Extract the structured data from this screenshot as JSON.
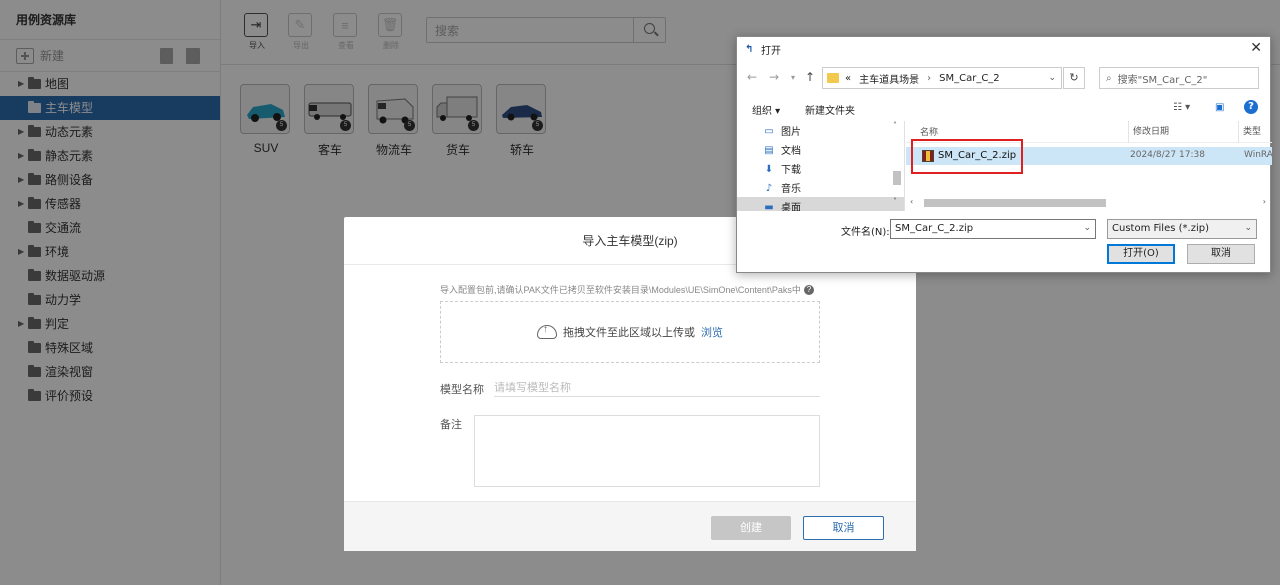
{
  "sidebar": {
    "title": "用例资源库",
    "new_label": "新建",
    "items": [
      {
        "label": "地图",
        "has_children": true
      },
      {
        "label": "主车模型",
        "has_children": false,
        "active": true
      },
      {
        "label": "动态元素",
        "has_children": true
      },
      {
        "label": "静态元素",
        "has_children": true
      },
      {
        "label": "路侧设备",
        "has_children": true
      },
      {
        "label": "传感器",
        "has_children": true
      },
      {
        "label": "交通流",
        "has_children": false
      },
      {
        "label": "环境",
        "has_children": true
      },
      {
        "label": "数据驱动源",
        "has_children": false
      },
      {
        "label": "动力学",
        "has_children": false
      },
      {
        "label": "判定",
        "has_children": true
      },
      {
        "label": "特殊区域",
        "has_children": false
      },
      {
        "label": "渲染视窗",
        "has_children": false
      },
      {
        "label": "评价预设",
        "has_children": false
      }
    ]
  },
  "toolbar": {
    "import_label": "导入",
    "export_label": "导出",
    "view_label": "查看",
    "delete_label": "删除",
    "search_placeholder": "搜索"
  },
  "vehicles": [
    {
      "name": "SUV",
      "color": "#2aa7c9"
    },
    {
      "name": "客车",
      "color": "#d8d8d8"
    },
    {
      "name": "物流车",
      "color": "#ededed"
    },
    {
      "name": "货车",
      "color": "#e0e0e0"
    },
    {
      "name": "轿车",
      "color": "#2e4f86"
    }
  ],
  "import_dialog": {
    "title": "导入主车模型(zip)",
    "hint": "导入配置包前,请确认PAK文件已拷贝至软件安装目录\\Modules\\UE\\SimOne\\Content\\Paks中",
    "drop_text": "拖拽文件至此区域以上传或",
    "browse_label": "浏览",
    "name_label": "模型名称",
    "name_placeholder": "请填写模型名称",
    "remark_label": "备注",
    "create_label": "创建",
    "cancel_label": "取消"
  },
  "open_dialog": {
    "title": "打开",
    "breadcrumb_prefix": "«",
    "path": [
      "主车道具场景",
      "SM_Car_C_2"
    ],
    "search_placeholder": "搜索\"SM_Car_C_2\"",
    "organize_label": "组织 ▾",
    "new_folder_label": "新建文件夹",
    "nav_items": [
      {
        "label": "图片",
        "icon": "pictures-icon"
      },
      {
        "label": "文档",
        "icon": "documents-icon"
      },
      {
        "label": "下载",
        "icon": "downloads-icon"
      },
      {
        "label": "音乐",
        "icon": "music-icon"
      },
      {
        "label": "桌面",
        "icon": "desktop-icon",
        "selected": true
      }
    ],
    "columns": {
      "name": "名称",
      "date": "修改日期",
      "type": "类型"
    },
    "files": [
      {
        "name": "SM_Car_C_2.zip",
        "date": "2024/8/27 17:38",
        "type": "WinRA"
      }
    ],
    "filename_label": "文件名(N):",
    "filename_value": "SM_Car_C_2.zip",
    "filetype_value": "Custom Files (*.zip)",
    "open_label": "打开(O)",
    "cancel_label": "取消"
  }
}
